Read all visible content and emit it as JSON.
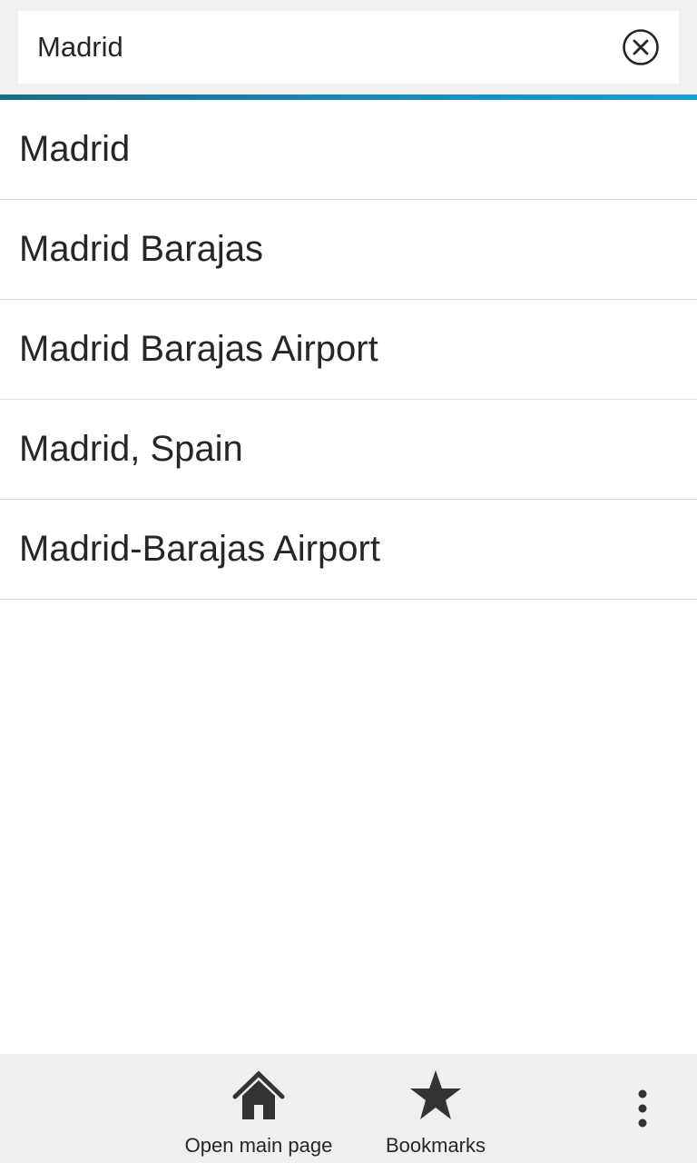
{
  "search": {
    "value": "Madrid",
    "clear_icon": "close-circle-icon"
  },
  "colors": {
    "accent_start": "#1b6c8c",
    "accent_end": "#1aa0d8",
    "text": "#262626",
    "action_bar_bg": "#efefef"
  },
  "suggestions": [
    {
      "label": "Madrid"
    },
    {
      "label": "Madrid Barajas"
    },
    {
      "label": "Madrid Barajas Airport"
    },
    {
      "label": "Madrid, Spain"
    },
    {
      "label": "Madrid-Barajas Airport"
    }
  ],
  "action_bar": {
    "home": {
      "label": "Open main page",
      "icon": "home-icon"
    },
    "bookmarks": {
      "label": "Bookmarks",
      "icon": "star-icon"
    },
    "overflow": {
      "icon": "vertical-ellipsis-icon"
    }
  }
}
